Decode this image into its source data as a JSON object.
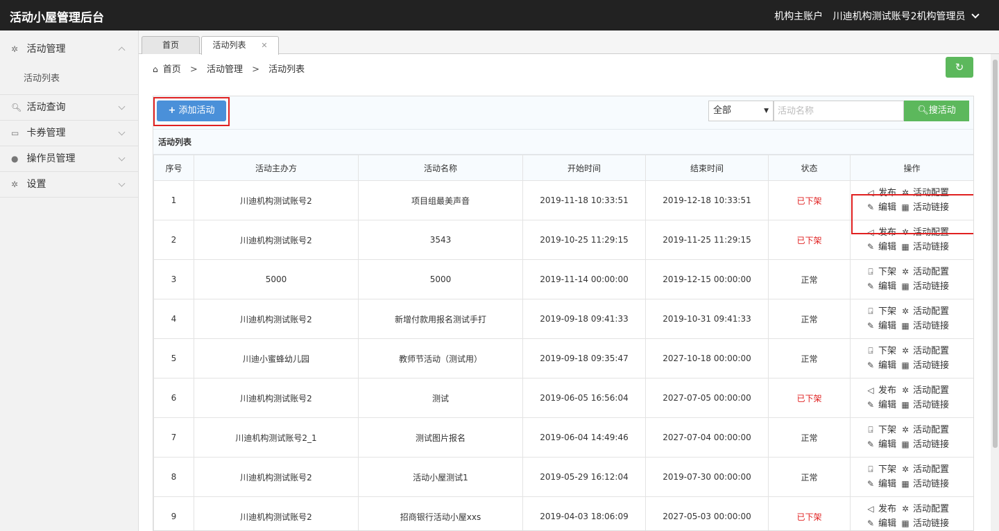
{
  "app": {
    "title": "活动小屋管理后台"
  },
  "account": {
    "type": "机构主账户",
    "name": "川迪机构测试账号2机构管理员"
  },
  "sidebar": {
    "items": [
      {
        "label": "活动管理",
        "icon": "gear-icon",
        "expanded": true,
        "children": [
          {
            "label": "活动列表"
          }
        ]
      },
      {
        "label": "活动查询",
        "icon": "search-icon"
      },
      {
        "label": "卡券管理",
        "icon": "card-icon"
      },
      {
        "label": "操作员管理",
        "icon": "user-icon"
      },
      {
        "label": "设置",
        "icon": "gear-icon"
      }
    ]
  },
  "tabs": [
    {
      "label": "首页",
      "active": false
    },
    {
      "label": "活动列表",
      "active": true,
      "closable": true
    }
  ],
  "breadcrumb": [
    "首页",
    "活动管理",
    "活动列表"
  ],
  "toolbar": {
    "add_label": "添加活动",
    "status_select": {
      "value": "全部"
    },
    "search": {
      "placeholder": "活动名称",
      "button_label": "搜活动"
    }
  },
  "list": {
    "title": "活动列表",
    "columns": [
      "序号",
      "活动主办方",
      "活动名称",
      "开始时间",
      "结束时间",
      "状态",
      "操作"
    ],
    "rows": [
      {
        "no": "1",
        "organizer": "川迪机构测试账号2",
        "name": "项目组最美声音",
        "start": "2019-11-18 10:33:51",
        "end": "2019-12-18 10:33:51",
        "status": "已下架",
        "off": true
      },
      {
        "no": "2",
        "organizer": "川迪机构测试账号2",
        "name": "3543",
        "start": "2019-10-25 11:29:15",
        "end": "2019-11-25 11:29:15",
        "status": "已下架",
        "off": true
      },
      {
        "no": "3",
        "organizer": "5000",
        "name": "5000",
        "start": "2019-11-14 00:00:00",
        "end": "2019-12-15 00:00:00",
        "status": "正常",
        "off": false
      },
      {
        "no": "4",
        "organizer": "川迪机构测试账号2",
        "name": "新增付款用报名测试手打",
        "start": "2019-09-18 09:41:33",
        "end": "2019-10-31 09:41:33",
        "status": "正常",
        "off": false
      },
      {
        "no": "5",
        "organizer": "川迪小蜜蜂幼儿园",
        "name": "教师节活动（测试用）",
        "start": "2019-09-18 09:35:47",
        "end": "2027-10-18 00:00:00",
        "status": "正常",
        "off": false
      },
      {
        "no": "6",
        "organizer": "川迪机构测试账号2",
        "name": "测试",
        "start": "2019-06-05 16:56:04",
        "end": "2027-07-05 00:00:00",
        "status": "已下架",
        "off": true
      },
      {
        "no": "7",
        "organizer": "川迪机构测试账号2_1",
        "name": "测试图片报名",
        "start": "2019-06-04 14:49:46",
        "end": "2027-07-04 00:00:00",
        "status": "正常",
        "off": false
      },
      {
        "no": "8",
        "organizer": "川迪机构测试账号2",
        "name": "活动小屋测试1",
        "start": "2019-05-29 16:12:04",
        "end": "2019-07-30 00:00:00",
        "status": "正常",
        "off": false
      },
      {
        "no": "9",
        "organizer": "川迪机构测试账号2",
        "name": "招商银行活动小屋xxs",
        "start": "2019-04-03 18:06:09",
        "end": "2027-05-03 00:00:00",
        "status": "已下架",
        "off": true
      }
    ],
    "actions": {
      "publish": "发布",
      "unpublish": "下架",
      "config": "活动配置",
      "edit": "编辑",
      "link": "活动链接"
    }
  }
}
